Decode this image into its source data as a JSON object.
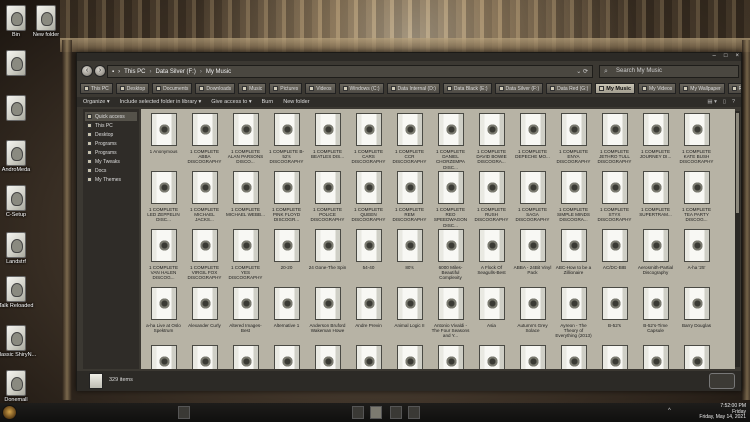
{
  "desktop": {
    "icons": [
      {
        "label": "Bin"
      },
      {
        "label": "New folder"
      },
      {
        "label": ""
      },
      {
        "label": ""
      },
      {
        "label": "AndroMeda"
      },
      {
        "label": "C-Setup"
      },
      {
        "label": "Landstrf"
      },
      {
        "label": "Talk Reloaded"
      },
      {
        "label": "Classic ShiryN..."
      },
      {
        "label": "Donemall"
      }
    ]
  },
  "window": {
    "address": {
      "crumbs": [
        "This PC",
        "Data Silver (F:)",
        "My Music"
      ],
      "separator": "›"
    },
    "search": {
      "placeholder": "Search My Music"
    },
    "controls": {
      "minimize": "–",
      "maximize": "□",
      "close": "×"
    },
    "tabs": [
      {
        "label": "This PC"
      },
      {
        "label": "Desktop"
      },
      {
        "label": "Documents"
      },
      {
        "label": "Downloads"
      },
      {
        "label": "Music"
      },
      {
        "label": "Pictures"
      },
      {
        "label": "Videos"
      },
      {
        "label": "Windows (C:)"
      },
      {
        "label": "Data Internal (D:)"
      },
      {
        "label": "Data Black (E:)"
      },
      {
        "label": "Data Silver (F:)"
      },
      {
        "label": "Data Red (G:)"
      },
      {
        "label": "My Music",
        "active": true
      },
      {
        "label": "My Videos"
      },
      {
        "label": "My Wallpaper"
      },
      {
        "label": "Recycle Bin"
      }
    ],
    "command_bar": {
      "organize": "Organize ▾",
      "include": "Include selected folder in library ▾",
      "give_access": "Give access to ▾",
      "burn": "Burn",
      "new_folder": "New folder"
    },
    "nav_pane": [
      {
        "label": "Quick access",
        "selected": true
      },
      {
        "label": "This PC"
      },
      {
        "label": "Desktop"
      },
      {
        "label": "Programs"
      },
      {
        "label": "Programs"
      },
      {
        "label": "My Tweaks"
      },
      {
        "label": "Docs"
      },
      {
        "label": "My Themes"
      }
    ],
    "items": [
      "1 Anonymous",
      "1 COMPLETE ABBA DISCOGRAPHY",
      "1 COMPLETE ALAN PARSONS DISCO...",
      "1 COMPLETE B-52's DISCOGRAPHY",
      "1 COMPLETE BEATLES DIS...",
      "1 COMPLETE CARS DISCOGRAPHY",
      "1 COMPLETE CCR DISCOGRAPHY",
      "1 COMPLETE DANIEL CHORZEMPA DISC...",
      "1 COMPLETE DAVID BOWIE DISCOGRA...",
      "1 COMPLETE DEPECHE MO...",
      "1 COMPLETE ENYA DISCOGRAPHY",
      "1 COMPLETE JETHRO TULL DISCOGRAPHY",
      "1 COMPLETE JOURNEY DI...",
      "1 COMPLETE KATE BUSH DISCOGRAPHY",
      "1 COMPLETE LED ZEPPELIN DISC...",
      "1 COMPLETE MICHAEL JACKS...",
      "1 COMPLETE MICHAEL WEBB...",
      "1 COMPLETE PINK FLOYD DISCOGR...",
      "1 COMPLETE POLICE DISCOGRAPHY",
      "1 COMPLETE QUEEN DISCOGRAPHY",
      "1 COMPLETE REM DISCOGRAPHY",
      "1 COMPLETE REO SPEEDWAGON DISC...",
      "1 COMPLETE RUSH DISCOGRAPHY",
      "1 COMPLETE SAGA DISCOGRAPHY",
      "1 COMPLETE SIMPLE MINDS DISCOGRA...",
      "1 COMPLETE STYX DISCOGRAPHY",
      "1 COMPLETE SUPERTRAM...",
      "1 COMPLETE TEA PARTY DISCOG...",
      "1 COMPLETE VAN HALEN DISCOG...",
      "1 COMPLETE VIRGIL FOX DISCOGRAPHY",
      "1 COMPLETE YES DISCOGRAPHY",
      "20-20",
      "24 Gone-The Spin",
      "54-40",
      "80's",
      "6000 Miles-Beautiful Complexity",
      "A Flock Of Seagulls-Best",
      "ABBA - 24Bit Vinyl Pack",
      "ABC-How to be a Zillionaire",
      "AC/DC-BIB",
      "Aerosmith-Partial Discography",
      "A-ha '25'",
      "a-ha Live at Oslo Spektrum",
      "Alexander Curly",
      "Altered Images-Best",
      "Alternative 1",
      "Anderson Bruford Wakeman Howe",
      "Andre Previn",
      "Animal Logic II",
      "Antonio Vivaldi - The Four Seasons and Y...",
      "Asia",
      "Autumn's Grey Solace",
      "Ayreon - The Theory of Everything (2013)",
      "B-52's",
      "B-52's-Time Capsule",
      "Barry Douglas",
      "",
      "",
      "",
      "",
      "",
      "",
      "",
      "",
      "",
      "",
      "",
      "",
      "",
      ""
    ],
    "status": {
      "count": "329 items"
    }
  },
  "taskbar": {
    "tray_arrow": "^",
    "time": "7:52:00 PM",
    "day": "Friday",
    "date": "Friday, May 14, 2021"
  }
}
